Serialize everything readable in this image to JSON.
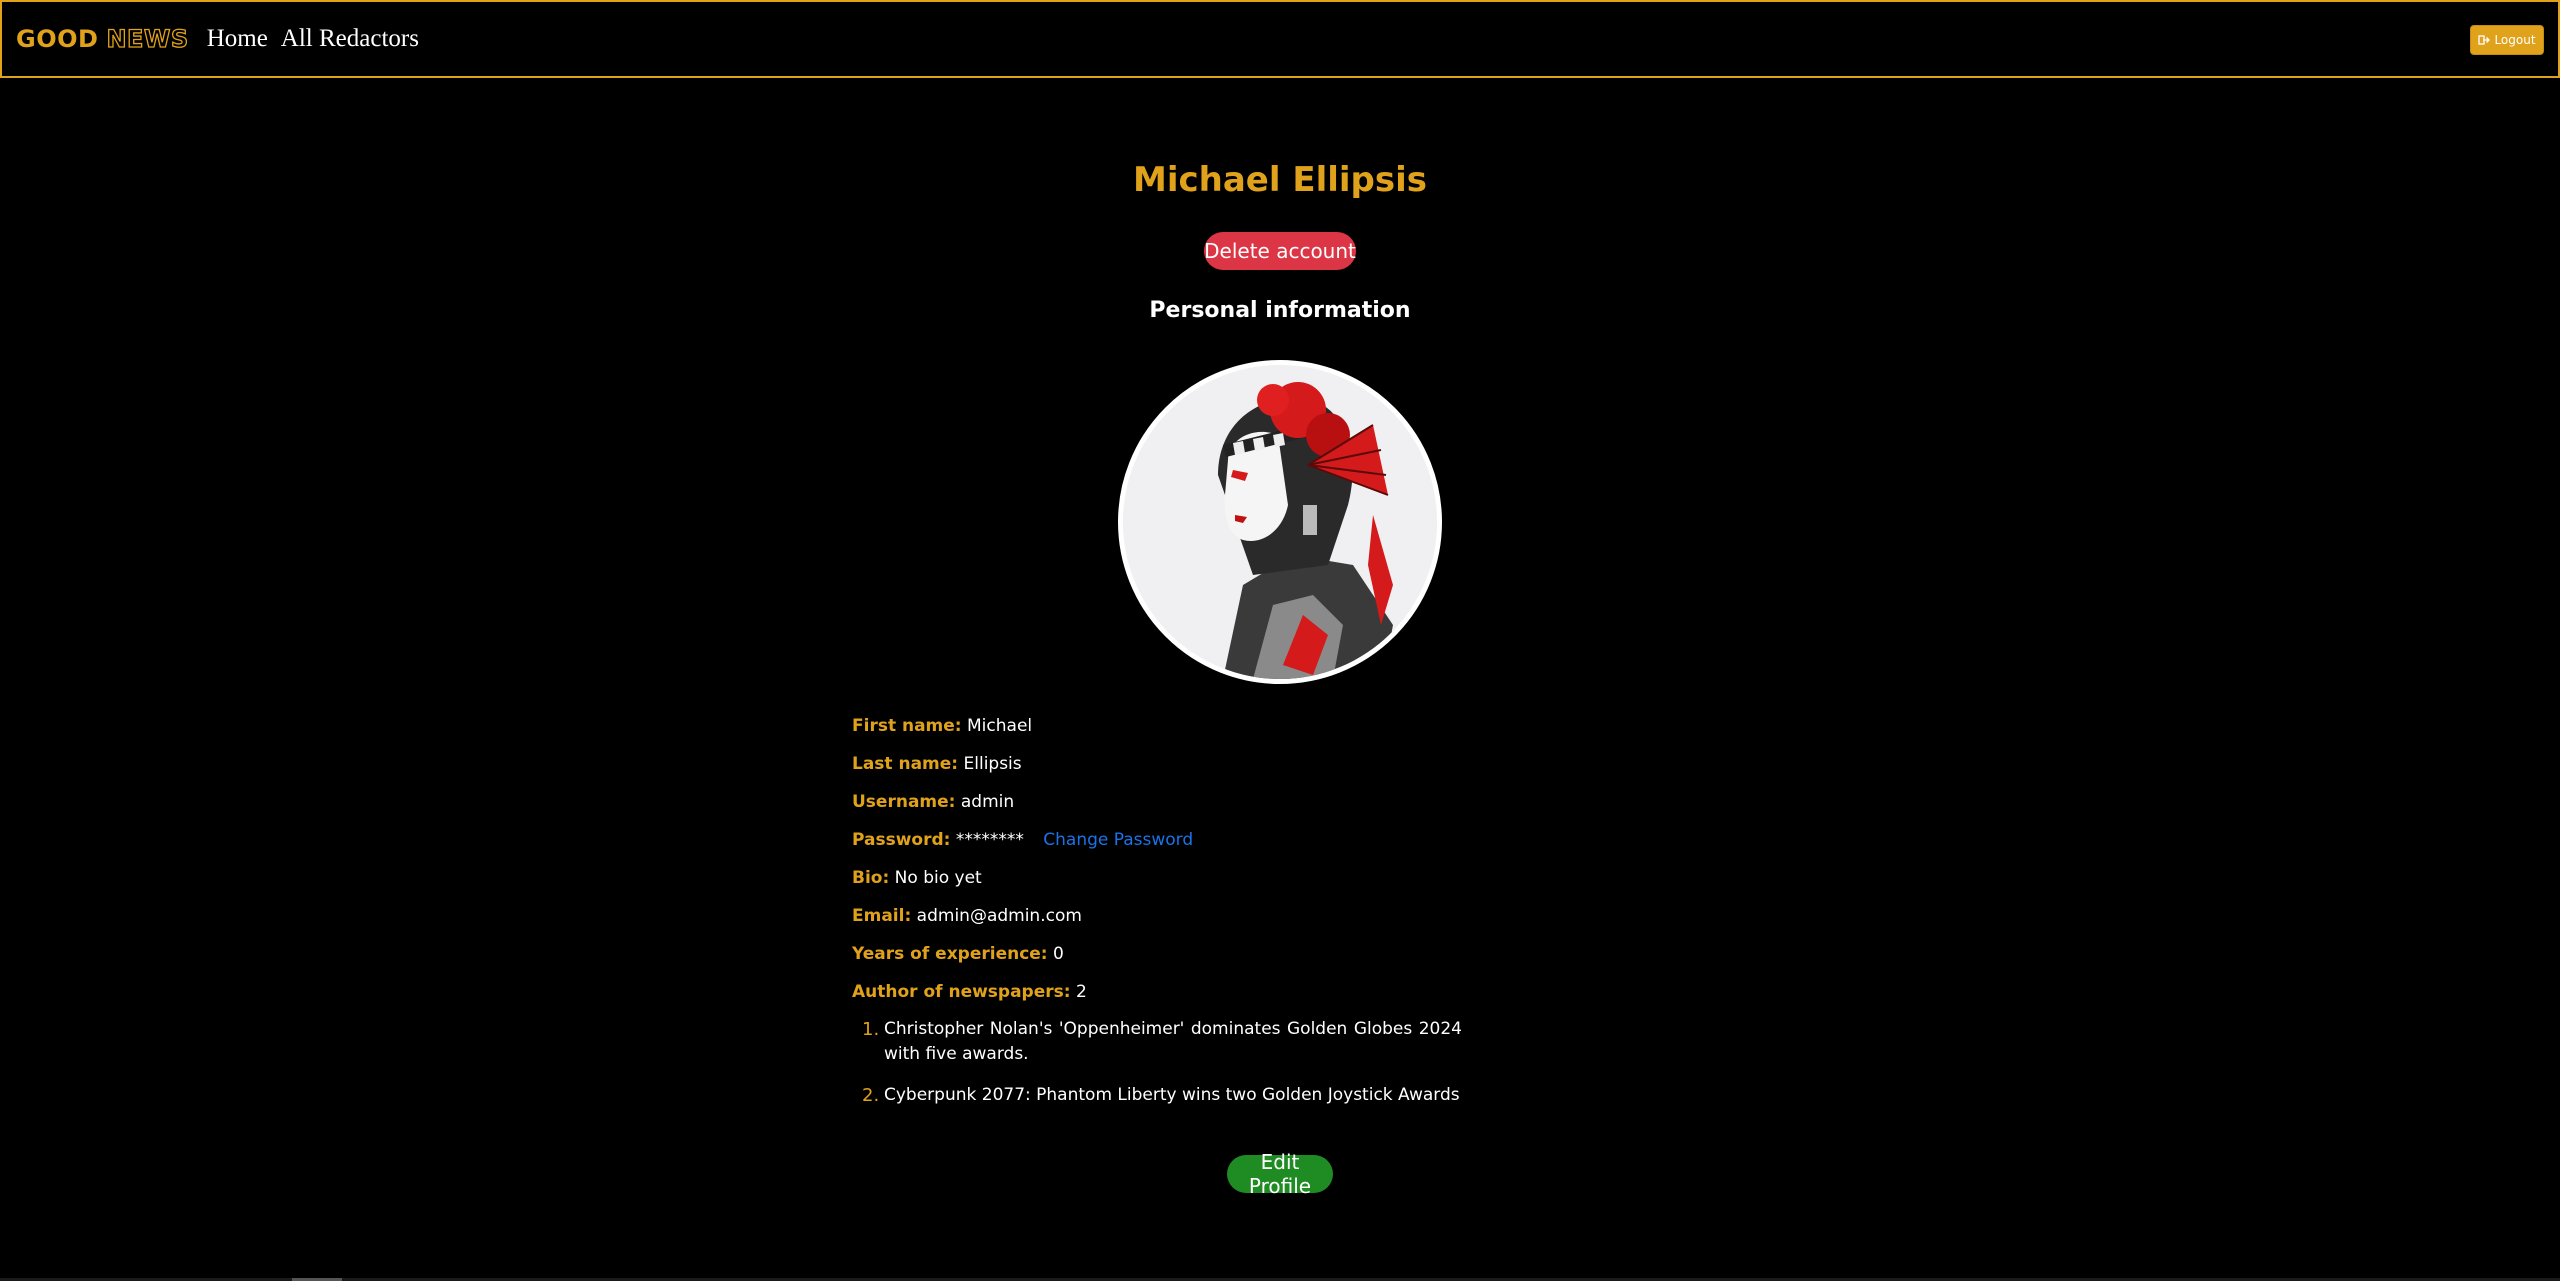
{
  "nav": {
    "brand_good": "GOOD",
    "brand_news": "NEWS",
    "home": "Home",
    "all_redactors": "All Redactors",
    "logout": "Logout"
  },
  "profile": {
    "name": "Michael Ellipsis",
    "delete_button": "Delete account",
    "section_title": "Personal information",
    "edit_button": "Edit Profile"
  },
  "fields": {
    "first_name_label": "First name:",
    "first_name": "Michael",
    "last_name_label": "Last name:",
    "last_name": "Ellipsis",
    "username_label": "Username:",
    "username": "admin",
    "password_label": "Password:",
    "password": "********",
    "change_password": "Change Password",
    "bio_label": "Bio:",
    "bio": "No bio yet",
    "email_label": "Email:",
    "email": "admin@admin.com",
    "experience_label": "Years of experience:",
    "experience": "0",
    "author_label": "Author of newspapers:",
    "author_count": "2"
  },
  "articles": [
    {
      "num": "1.",
      "title": "Christopher Nolan's 'Oppenheimer' dominates Golden Globes 2024 with five awards."
    },
    {
      "num": "2.",
      "title": "Cyberpunk 2077: Phantom Liberty wins two Golden Joystick Awards"
    }
  ],
  "colors": {
    "accent": "#e0a21b",
    "danger": "#dc3545",
    "success": "#1e8c23",
    "link": "#1a73e8"
  },
  "icons": {
    "logout": "logout-icon",
    "avatar": "avatar-image"
  }
}
